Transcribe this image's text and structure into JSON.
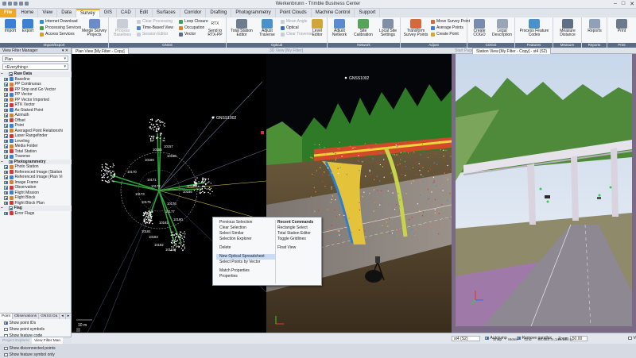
{
  "window": {
    "title": "Werkenbrunn - Trimble Business Center",
    "controls": [
      "–",
      "□",
      "✕"
    ]
  },
  "tabs": [
    "File",
    "Home",
    "View",
    "Data",
    "Survey",
    "GIS",
    "CAD",
    "Edit",
    "Surfaces",
    "Corridor",
    "Drafting",
    "Photogrammetry",
    "Point Clouds",
    "Machine Control",
    "Support"
  ],
  "active_tab": "Survey",
  "ribbon": {
    "groups": [
      {
        "label": "Import/Export"
      },
      {
        "label": "GNSS"
      },
      {
        "label": "Optical"
      },
      {
        "label": "Network"
      },
      {
        "label": "Adjust"
      },
      {
        "label": "COGO"
      },
      {
        "label": "Features"
      },
      {
        "label": "Measure"
      },
      {
        "label": "Reports"
      },
      {
        "label": "Print"
      }
    ],
    "import": "Import",
    "export": "Export",
    "internet_download": "Internet Download",
    "processing_services": "Processing Services",
    "access_services": "Access Services",
    "merge_survey_projects": "Merge Survey Projects",
    "process_baselines": "Process Baselines",
    "clear_processing": "Clear Processing",
    "time_based_view": "Time-Based View",
    "session_editor": "Session Editor",
    "loop_closure": "Loop Closure",
    "occupation": "Occupation",
    "vector": "Vector",
    "send_to_rtx_pp": "Send to RTX-PP",
    "rtx_label": "RTX",
    "total_station_editor": "Total Station Editor",
    "adjust_traverse": "Adjust Traverse",
    "mean_angle": "Mean Angle",
    "optical": "Optical",
    "clear_traverse": "Clear Traverse",
    "level_editor": "Level Editor",
    "adjust_network": "Adjust Network",
    "site_calibration": "Site Calibration",
    "local_site_settings": "Local Site Settings",
    "transform_survey_points": "Transform Survey Points",
    "move_survey_point": "Move Survey Point",
    "average_points": "Average Points",
    "create_point": "Create Point",
    "create_cogo": "Create COGO",
    "legal_description": "Legal Description",
    "process_feature_codes": "Process Feature Codes",
    "measure_distance": "Measure Distance",
    "reports": "Reports",
    "print": "Print"
  },
  "left_panel": {
    "title": "View Filter Manager",
    "pin": "▾ ✕",
    "combo1": "Plan",
    "combo2": "<Everything>",
    "sections": [
      {
        "name": "Raw Data",
        "items": [
          "Baseline",
          "PP Continuous",
          "PP Stop and Go Vector",
          "PP Vector",
          "PP Vector Imported",
          "RTK Vector",
          "As-Staked Point",
          "Azimuth",
          "Offset",
          "Point",
          "Averaged Point Relationshi",
          "Laser Rangefinder",
          "Leveling",
          "Media Folder",
          "Total Station",
          "Traverse"
        ]
      },
      {
        "name": "Photogrammetry",
        "items": [
          "Photo Station",
          "Referenced Image (Station",
          "Referenced Image (Plan Vi",
          "Image Frame",
          "Observation",
          "Flight Mission",
          "Flight Block",
          "Flight Block Plan"
        ]
      },
      {
        "name": "Flag",
        "items": [
          "Error Flags"
        ]
      }
    ],
    "subtabs": [
      "Point",
      "Observations",
      "GNSS Da",
      "◂",
      "▸"
    ],
    "options": [
      {
        "label": "Show point IDs",
        "checked": true
      },
      {
        "label": "Show point symbols",
        "checked": false
      },
      {
        "label": "Show feature code",
        "checked": false
      },
      {
        "label": "Show elevation",
        "checked": false
      },
      {
        "label": "Show disconnected points",
        "checked": false
      },
      {
        "label": "Show feature symbol only",
        "checked": false
      }
    ],
    "bottom_tabs": [
      "Project Explorer",
      "View Filter Man"
    ]
  },
  "panes": {
    "plan_tab": "Plan View [My Filter - Copy]",
    "view3d_tab": "3D View [My Filter]",
    "station_tabs": [
      "Start Page",
      "Station View [My Filter - Copy] - st4 (S2)"
    ],
    "scale_label": "10 m",
    "gnss_label": "GNSS1002",
    "point_labels": [
      "10155",
      "10157",
      "10158",
      "10169",
      "10170",
      "10171",
      "10172",
      "10173",
      "10175",
      "10176",
      "10177",
      "10160",
      "10166",
      "10167",
      "10162",
      "10181",
      "10183",
      "10182",
      "10163"
    ]
  },
  "context_menu": {
    "left_items": [
      "Previous Selection",
      "Clear Selection",
      "Select Similar",
      "Selection Explorer",
      "—",
      "Delete",
      "—",
      "New Optical Spreadsheet",
      "Select Points by Vector",
      "—",
      "Match Properties",
      "Properties"
    ],
    "highlighted": "New Optical Spreadsheet",
    "right_header": "Recent Commands",
    "right_items": [
      "Rectangle Select",
      "Total Station Editor",
      "Toggle Gridlines",
      "—",
      "Float View"
    ]
  },
  "status_bar": {
    "station_combo": "st4 (S2)",
    "autojump": "Autojump",
    "remove_parallax": "Remove parallax",
    "zoom_label": "Zoom",
    "zoom_value": "50.00",
    "snap": "Snap",
    "units": "Meter",
    "grid": "Grid",
    "coords": "98.984 m,145.164 m",
    "ve": "Ve"
  },
  "colors": {
    "file_tab": "#f0a81c",
    "accent": "#2a6fc9",
    "point_green": "#2fa43a",
    "highlight": "#c9dcf3"
  }
}
